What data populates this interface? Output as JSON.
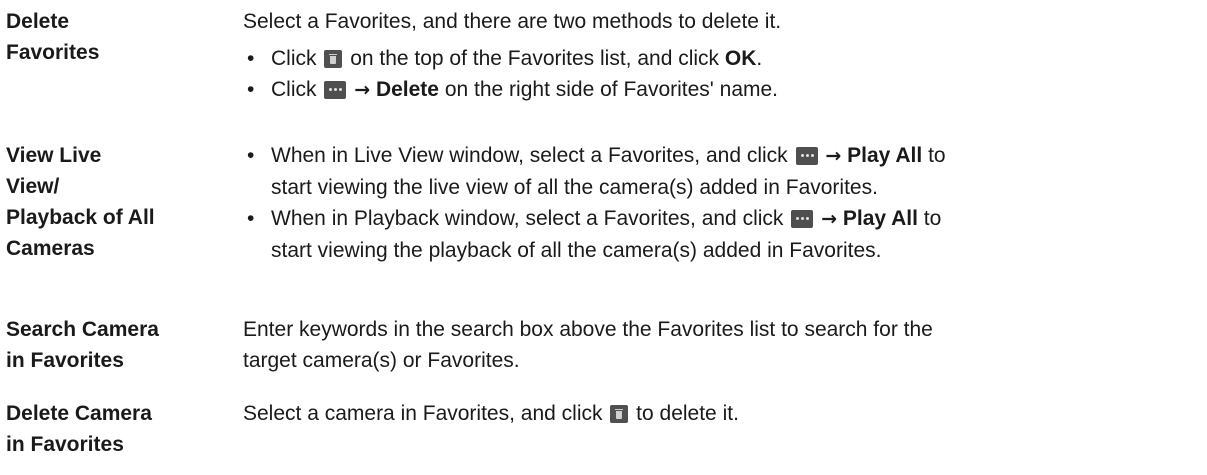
{
  "rows": [
    {
      "label": "Delete Favorites",
      "intro": "Select a Favorites, and there are two methods to delete it.",
      "bullets": [
        {
          "pre": "Click",
          "post": "on the top of the Favorites list, and click",
          "bold": "OK",
          "end": "."
        },
        {
          "pre": "Click",
          "arrow": "→",
          "bold": "Delete",
          "post": "on the right side of Favorites' name."
        }
      ]
    },
    {
      "label_lines": [
        "View Live",
        "View/",
        "Playback of All",
        "Cameras"
      ],
      "bullets": [
        {
          "pre": "When in Live View window, select a Favorites, and click",
          "arrow": "→",
          "bold": "Play All",
          "post": "to",
          "line2": "start viewing the live view of all the camera(s) added in Favorites."
        },
        {
          "pre": "When in Playback window, select a Favorites, and click",
          "arrow": "→",
          "bold": "Play All",
          "post": "to",
          "line2": "start viewing the playback of all the camera(s) added in Favorites."
        }
      ]
    },
    {
      "label_lines": [
        "Search Camera",
        "in Favorites"
      ],
      "text_lines": [
        "Enter keywords in the search box above the Favorites list to search for the",
        "target camera(s) or Favorites."
      ]
    },
    {
      "label_lines": [
        "Delete Camera",
        "in Favorites"
      ],
      "pre": "Select a camera in Favorites, and click",
      "post": "to delete it."
    }
  ],
  "bullet_char": "•",
  "icons": [
    "trash-icon",
    "more-icon"
  ]
}
